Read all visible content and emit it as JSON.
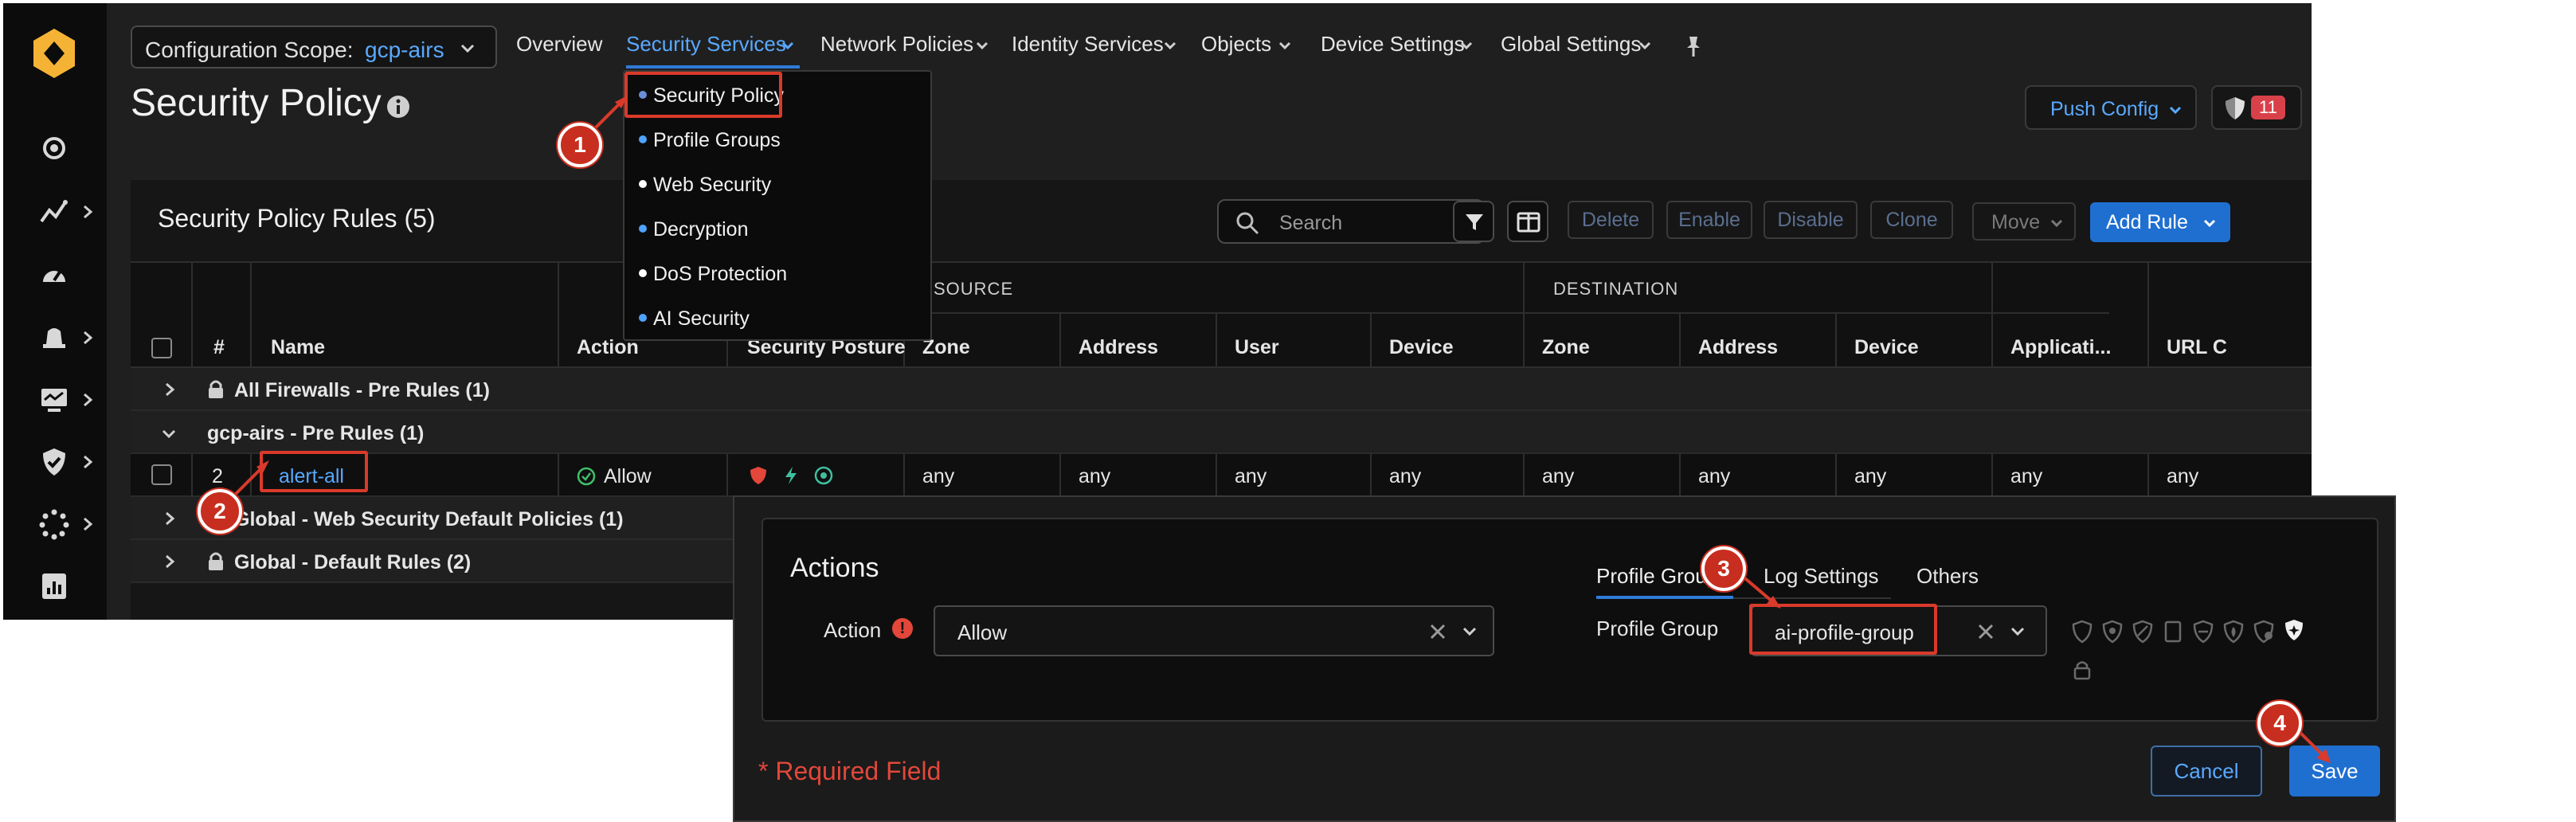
{
  "scope": {
    "label": "Configuration Scope:",
    "value": "gcp-airs"
  },
  "nav": [
    {
      "label": "Overview"
    },
    {
      "label": "Security Services"
    },
    {
      "label": "Network Policies"
    },
    {
      "label": "Identity Services"
    },
    {
      "label": "Objects"
    },
    {
      "label": "Device Settings"
    },
    {
      "label": "Global Settings"
    }
  ],
  "page": {
    "title": "Security Policy"
  },
  "header_actions": {
    "push_config": "Push Config",
    "alert_count": "11"
  },
  "dropdown": {
    "items": [
      {
        "label": "Security Policy",
        "dot": "#6a8fd8"
      },
      {
        "label": "Profile Groups",
        "dot": "#4ea3ff"
      },
      {
        "label": "Web Security",
        "dot": "#ffffff"
      },
      {
        "label": "Decryption",
        "dot": "#4ea3ff"
      },
      {
        "label": "DoS Protection",
        "dot": "#ffffff"
      },
      {
        "label": "AI Security",
        "dot": "#4ea3ff"
      }
    ]
  },
  "table": {
    "title": "Security Policy Rules (5)",
    "search_placeholder": "Search",
    "buttons": {
      "delete": "Delete",
      "enable": "Enable",
      "disable": "Disable",
      "clone": "Clone",
      "move": "Move",
      "add_rule": "Add Rule"
    },
    "groups": {
      "source": "SOURCE",
      "destination": "DESTINATION"
    },
    "columns": {
      "num": "#",
      "name": "Name",
      "action": "Action",
      "posture": "Security Posture",
      "src_zone": "Zone",
      "src_address": "Address",
      "src_user": "User",
      "src_device": "Device",
      "dst_zone": "Zone",
      "dst_address": "Address",
      "dst_device": "Device",
      "application": "Applicati...",
      "url": "URL C"
    },
    "rows": {
      "group1": "All Firewalls - Pre Rules (1)",
      "group2": "gcp-airs - Pre Rules (1)",
      "rule": {
        "num": "2",
        "name": "alert-all",
        "action": "Allow",
        "src_zone": "any",
        "src_address": "any",
        "src_user": "any",
        "src_device": "any",
        "dst_zone": "any",
        "dst_address": "any",
        "dst_device": "any",
        "application": "any",
        "url": "any"
      },
      "group3": "Global - Web Security Default Policies (1)",
      "group4": "Global - Default Rules (2)"
    }
  },
  "dialog": {
    "title": "Actions",
    "tabs": [
      "Profile Group",
      "Log Settings",
      "Others"
    ],
    "action_label": "Action",
    "action_value": "Allow",
    "profile_group_label": "Profile Group",
    "profile_group_value": "ai-profile-group",
    "required_text": "* Required Field",
    "cancel": "Cancel",
    "save": "Save"
  },
  "callouts": [
    "1",
    "2",
    "3",
    "4"
  ],
  "colors": {
    "accent": "#1f6fd1",
    "link": "#5aa9ff",
    "highlight": "#d93a2b",
    "callout": "#c82e1f",
    "brand": "#f5b335"
  }
}
